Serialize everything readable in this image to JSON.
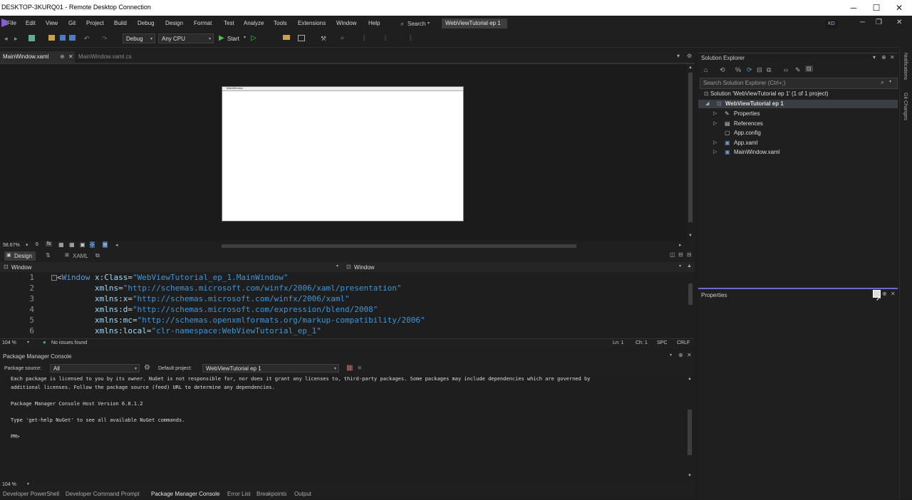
{
  "rdp": {
    "title": "DESKTOP-3KURQ01 - Remote Desktop Connection",
    "minimize": "─",
    "maximize": "☐",
    "close": "✕"
  },
  "menu": {
    "items": [
      "File",
      "Edit",
      "View",
      "Git",
      "Project",
      "Build",
      "Debug",
      "Design",
      "Format",
      "Test",
      "Analyze",
      "Tools",
      "Extensions",
      "Window",
      "Help"
    ],
    "search": "Search",
    "solution_name": "WebViewTutorial ep 1",
    "user_initials": "KD"
  },
  "toolbar": {
    "config": "Debug",
    "platform": "Any CPU",
    "start": "Start"
  },
  "doc_tabs": {
    "active": "MainWindow.xaml",
    "inactive": "MainWindow.xaml.cs"
  },
  "designer": {
    "window_title": "MainWindow",
    "zoom": "58.67%"
  },
  "view_tabs": {
    "design": "Design",
    "xaml": "XAML"
  },
  "xaml_nav": {
    "left": "Window",
    "right": "Window"
  },
  "editor": {
    "lines": [
      {
        "n": "1",
        "parts": [
          {
            "c": "tag",
            "t": "<"
          },
          {
            "c": "kw",
            "t": "Window"
          },
          {
            "c": "attr",
            "t": " x"
          },
          {
            "c": "tag",
            "t": ":"
          },
          {
            "c": "attr",
            "t": "Class"
          },
          {
            "c": "tag",
            "t": "="
          },
          {
            "c": "str",
            "t": "\"WebViewTutorial_ep_1.MainWindow\""
          }
        ]
      },
      {
        "n": "2",
        "parts": [
          {
            "c": "attr",
            "t": "        xmlns"
          },
          {
            "c": "tag",
            "t": "="
          },
          {
            "c": "str",
            "t": "\"http://schemas.microsoft.com/winfx/2006/xaml/presentation\""
          }
        ]
      },
      {
        "n": "3",
        "parts": [
          {
            "c": "attr",
            "t": "        xmlns"
          },
          {
            "c": "tag",
            "t": ":"
          },
          {
            "c": "attr",
            "t": "x"
          },
          {
            "c": "tag",
            "t": "="
          },
          {
            "c": "str",
            "t": "\"http://schemas.microsoft.com/winfx/2006/xaml\""
          }
        ]
      },
      {
        "n": "4",
        "parts": [
          {
            "c": "attr",
            "t": "        xmlns"
          },
          {
            "c": "tag",
            "t": ":"
          },
          {
            "c": "attr",
            "t": "d"
          },
          {
            "c": "tag",
            "t": "="
          },
          {
            "c": "str",
            "t": "\"http://schemas.microsoft.com/expression/blend/2008\""
          }
        ]
      },
      {
        "n": "5",
        "parts": [
          {
            "c": "attr",
            "t": "        xmlns"
          },
          {
            "c": "tag",
            "t": ":"
          },
          {
            "c": "attr",
            "t": "mc"
          },
          {
            "c": "tag",
            "t": "="
          },
          {
            "c": "str",
            "t": "\"http://schemas.openxmlformats.org/markup-compatibility/2006\""
          }
        ]
      },
      {
        "n": "6",
        "parts": [
          {
            "c": "attr",
            "t": "        xmlns"
          },
          {
            "c": "tag",
            "t": ":"
          },
          {
            "c": "attr",
            "t": "local"
          },
          {
            "c": "tag",
            "t": "="
          },
          {
            "c": "str",
            "t": "\"clr-namespace:WebViewTutorial_ep_1\""
          }
        ]
      }
    ],
    "zoom": "104 %",
    "issues": "No issues found",
    "ln": "Ln: 1",
    "ch": "Ch: 1",
    "spc": "SPC",
    "crlf": "CRLF"
  },
  "pmc": {
    "title": "Package Manager Console",
    "source_label": "Package source:",
    "source_value": "All",
    "project_label": "Default project:",
    "project_value": "WebViewTutorial ep 1",
    "output": [
      "Each package is licensed to you by its owner. NuGet is not responsible for, nor does it grant any licenses to, third-party packages. Some packages may include dependencies which are governed by",
      "additional licenses. Follow the package source (feed) URL to determine any dependencies.",
      "",
      "Package Manager Console Host Version 6.8.1.2",
      "",
      "Type 'get-help NuGet' to see all available NuGet commands.",
      "",
      "PM>"
    ],
    "zoom": "104 %"
  },
  "bottom_tabs": [
    "Developer PowerShell",
    "Developer Command Prompt",
    "Package Manager Console",
    "Error List",
    "Breakpoints",
    "Output"
  ],
  "solution_explorer": {
    "title": "Solution Explorer",
    "search_placeholder": "Search Solution Explorer (Ctrl+;)",
    "solution": "Solution 'WebViewTutorial ep 1' (1 of 1 project)",
    "project": "WebViewTutorial ep 1",
    "items": [
      "Properties",
      "References",
      "App.config",
      "App.xaml",
      "MainWindow.xaml"
    ]
  },
  "properties": {
    "title": "Properties"
  },
  "side_strip": {
    "notifications": "Notifications",
    "git_changes": "Git Changes"
  }
}
